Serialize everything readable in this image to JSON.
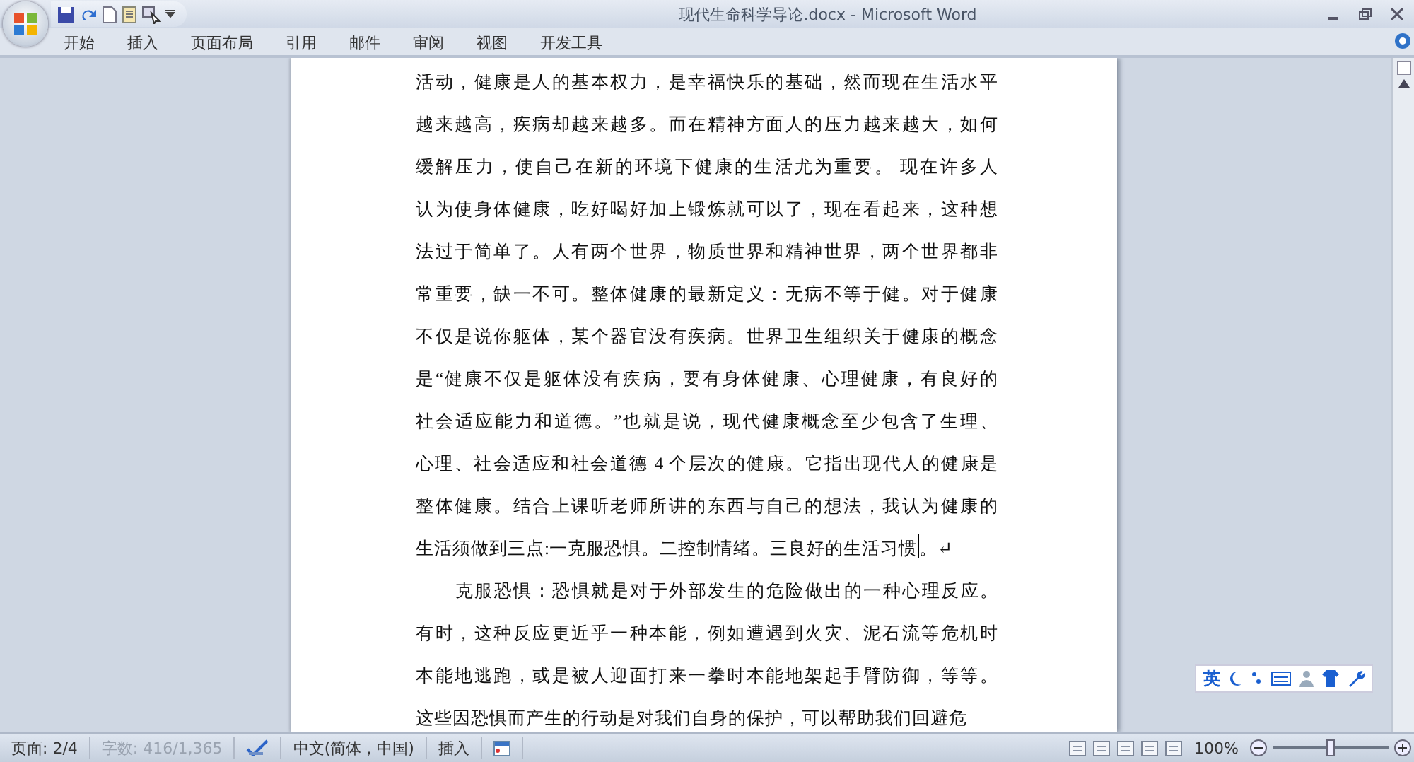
{
  "window": {
    "title": "现代生命科学导论.docx - Microsoft Word"
  },
  "ribbon_tabs": [
    {
      "label": "开始",
      "selected": false
    },
    {
      "label": "插入",
      "selected": false
    },
    {
      "label": "页面布局",
      "selected": false
    },
    {
      "label": "引用",
      "selected": false
    },
    {
      "label": "邮件",
      "selected": false
    },
    {
      "label": "审阅",
      "selected": false
    },
    {
      "label": "视图",
      "selected": false
    },
    {
      "label": "开发工具",
      "selected": false
    }
  ],
  "document": {
    "paragraphs": [
      {
        "indent": false,
        "lines": [
          "活动，健康是人的基本权力，是幸福快乐的基础，然而现在生活水平",
          "越来越高，疾病却越来越多。而在精神方面人的压力越来越大，如何",
          "缓解压力，使自己在新的环境下健康的生活尤为重要。 现在许多人",
          "认为使身体健康，吃好喝好加上锻炼就可以了，现在看起来，这种想",
          "法过于简单了。人有两个世界，物质世界和精神世界，两个世界都非",
          "常重要，缺一不可。整体健康的最新定义：无病不等于健。对于健康",
          "不仅是说你躯体，某个器官没有疾病。世界卫生组织关于健康的概念",
          "是“健康不仅是躯体没有疾病，要有身体健康、心理健康，有良好的",
          "社会适应能力和道德。”也就是说，现代健康概念至少包含了生理、",
          "心理、社会适应和社会道德 4 个层次的健康。它指出现代人的健康是",
          "整体健康。结合上课听老师所讲的东西与自己的想法，我认为健康的",
          "生活须做到三点:一克服恐惧。二控制情绪。三良好的生活习惯。"
        ],
        "cursor": true,
        "mark": "↵"
      },
      {
        "indent": true,
        "lines": [
          "克服恐惧：恐惧就是对于外部发生的危险做出的一种心理反应。",
          "有时，这种反应更近乎一种本能，例如遭遇到火灾、泥石流等危机时",
          "本能地逃跑，或是被人迎面打来一拳时本能地架起手臂防御，等等。",
          "这些因恐惧而产生的行动是对我们自身的保护，可以帮助我们回避危"
        ],
        "cursor": false
      }
    ]
  },
  "ime_toolbar": {
    "mode": "英"
  },
  "status_bar": {
    "page": "页面: 2/4",
    "word_count": {
      "text": "字数: 416/1,365",
      "disabled": true
    },
    "language": "中文(简体，中国)",
    "insert_mode": "插入",
    "zoom": "100%",
    "zoom_slider": {
      "level": 0.5
    }
  }
}
